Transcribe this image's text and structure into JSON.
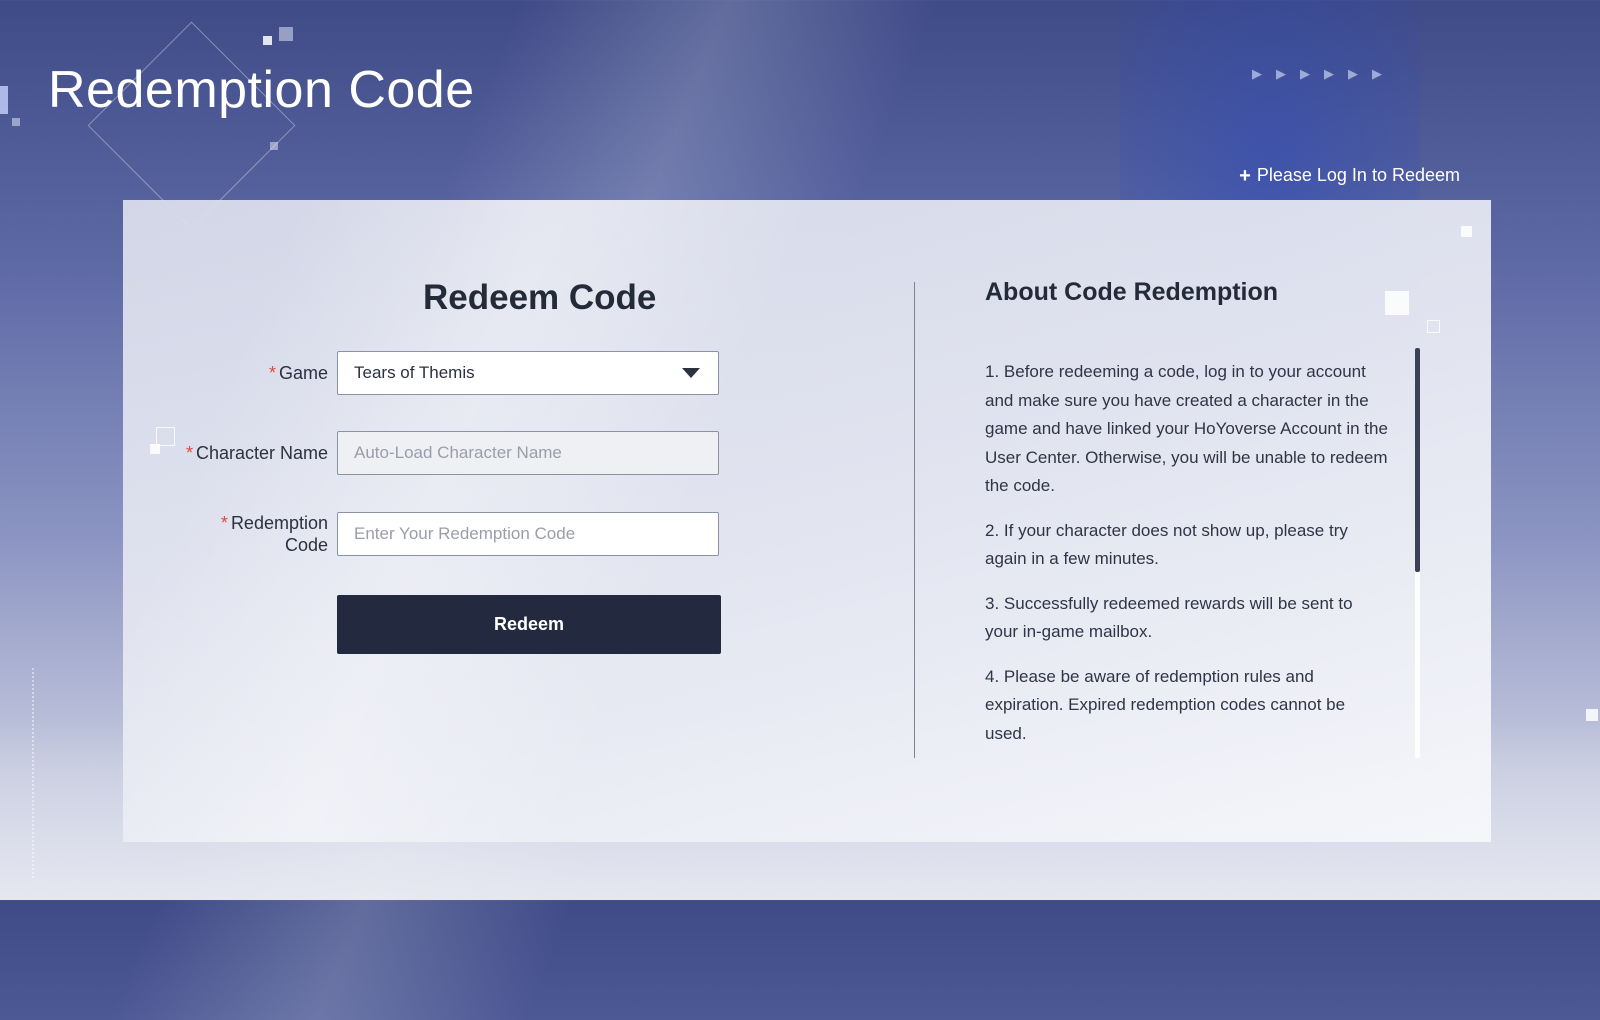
{
  "page": {
    "title": "Redemption Code",
    "login_link": "Please Log In to Redeem"
  },
  "form": {
    "title": "Redeem Code",
    "game": {
      "label": "Game",
      "selected": "Tears of Themis"
    },
    "character_name": {
      "label": "Character Name",
      "placeholder": "Auto-Load Character Name"
    },
    "redemption_code": {
      "label_line1": "Redemption",
      "label_line2": "Code",
      "placeholder": "Enter Your Redemption Code"
    },
    "required_mark": "*",
    "submit_label": "Redeem"
  },
  "about": {
    "title": "About Code Redemption",
    "items": [
      "1. Before redeeming a code, log in to your account and make sure you have created a character in the game and have linked your HoYoverse Account in the User Center. Otherwise, you will be unable to redeem the code.",
      "2. If your character does not show up, please try again  in a few minutes.",
      "3. Successfully  redeemed rewards will be sent to your in-game mailbox.",
      "4. Please be aware of redemption rules and expiration.  Expired redemption codes cannot be used."
    ]
  },
  "icons": {
    "login": "plus-icon",
    "dropdown": "chevron-down-icon",
    "decor": "arrow-right-icon"
  },
  "colors": {
    "accent_dark": "#232a40",
    "required": "#e04a3a"
  }
}
